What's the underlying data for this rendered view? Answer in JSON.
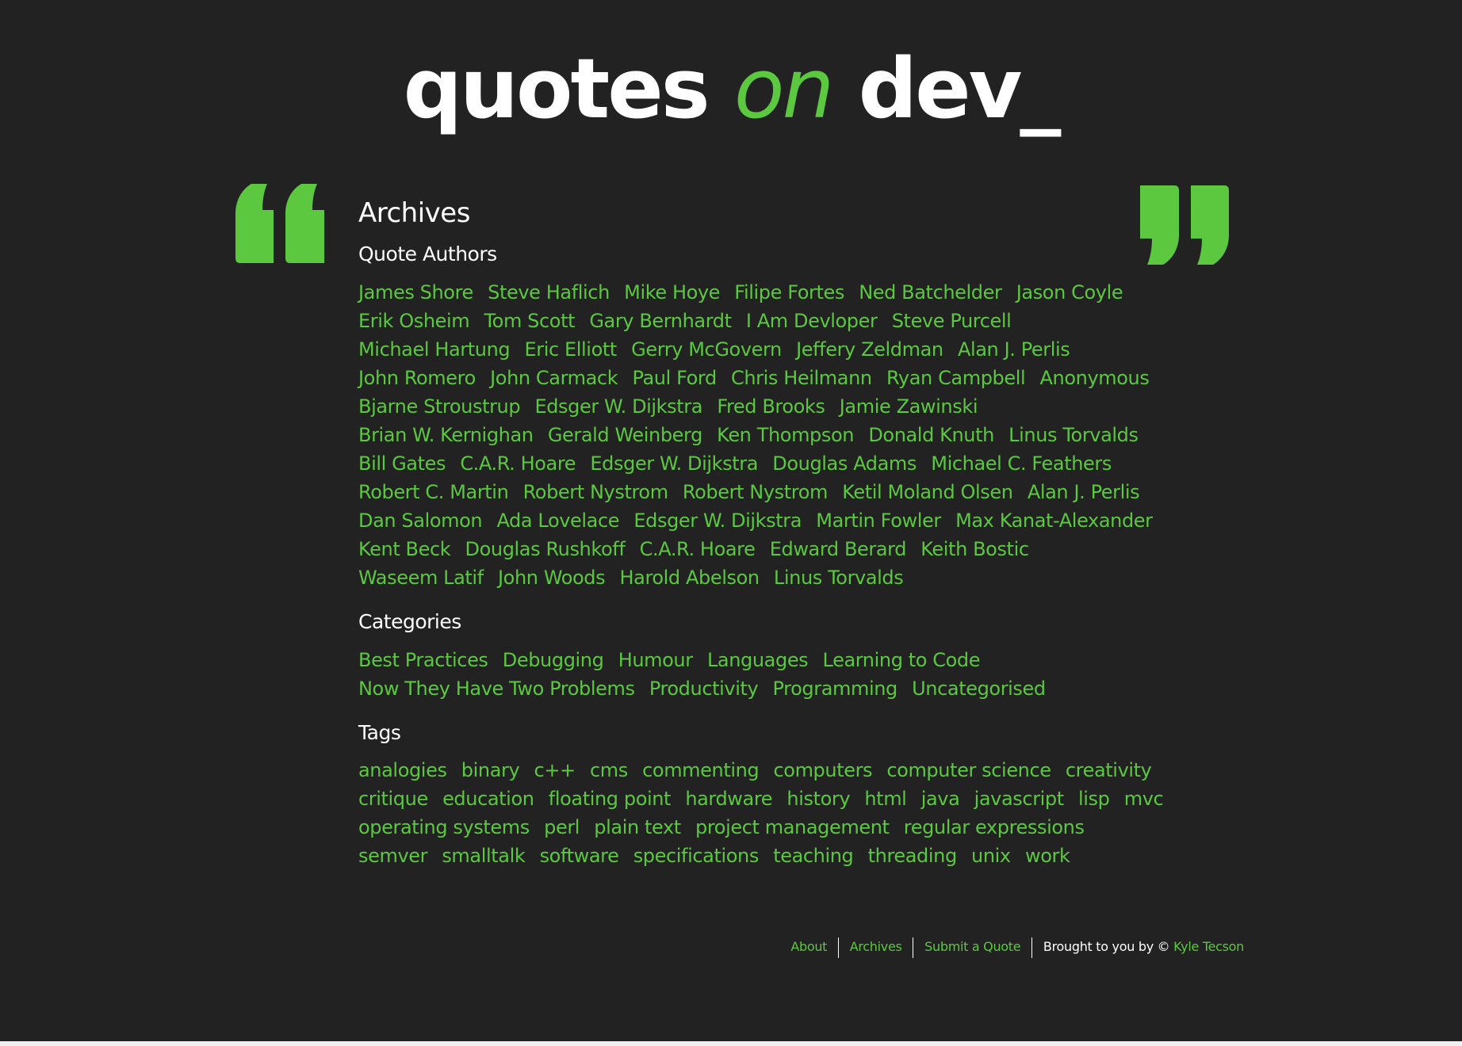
{
  "header": {
    "title_part1": "quotes",
    "title_part2": "on",
    "title_part3": "dev_"
  },
  "colors": {
    "background": "#222222",
    "accent": "#5bc840",
    "text": "#ffffff"
  },
  "icons": {
    "open_quote": "open-quote-icon",
    "close_quote": "close-quote-icon"
  },
  "main": {
    "page_title": "Archives",
    "authors": {
      "heading": "Quote Authors",
      "rows": [
        [
          "James Shore",
          "Steve Haflich",
          "Mike Hoye",
          "Filipe Fortes",
          "Ned Batchelder",
          "Jason Coyle"
        ],
        [
          "Erik Osheim",
          "Tom Scott",
          "Gary Bernhardt",
          "I Am Devloper",
          "Steve Purcell"
        ],
        [
          "Michael Hartung",
          "Eric Elliott",
          "Gerry McGovern",
          "Jeffery Zeldman",
          "Alan J. Perlis"
        ],
        [
          "John Romero",
          "John Carmack",
          "Paul Ford",
          "Chris Heilmann",
          "Ryan Campbell",
          "Anonymous"
        ],
        [
          "Bjarne Stroustrup",
          "Edsger W. Dijkstra",
          "Fred Brooks",
          "Jamie Zawinski"
        ],
        [
          "Brian W. Kernighan",
          "Gerald Weinberg",
          "Ken Thompson",
          "Donald Knuth",
          "Linus Torvalds"
        ],
        [
          "Bill Gates",
          "C.A.R. Hoare",
          "Edsger W. Dijkstra",
          "Douglas Adams",
          "Michael C. Feathers"
        ],
        [
          "Robert C. Martin",
          "Robert Nystrom",
          "Robert Nystrom",
          "Ketil Moland Olsen",
          "Alan J. Perlis"
        ],
        [
          "Dan Salomon",
          "Ada Lovelace",
          "Edsger W. Dijkstra",
          "Martin Fowler",
          "Max Kanat-Alexander"
        ],
        [
          "Kent Beck",
          "Douglas Rushkoff",
          "C.A.R. Hoare",
          "Edward Berard",
          "Keith Bostic"
        ],
        [
          "Waseem Latif",
          "John Woods",
          "Harold Abelson",
          "Linus Torvalds"
        ]
      ]
    },
    "categories": {
      "heading": "Categories",
      "rows": [
        [
          "Best Practices",
          "Debugging",
          "Humour",
          "Languages",
          "Learning to Code"
        ],
        [
          "Now They Have Two Problems",
          "Productivity",
          "Programming",
          "Uncategorised"
        ]
      ]
    },
    "tags": {
      "heading": "Tags",
      "rows": [
        [
          "analogies",
          "binary",
          "c++",
          "cms",
          "commenting",
          "computers",
          "computer science",
          "creativity"
        ],
        [
          "critique",
          "education",
          "floating point",
          "hardware",
          "history",
          "html",
          "java",
          "javascript",
          "lisp",
          "mvc"
        ],
        [
          "operating systems",
          "perl",
          "plain text",
          "project management",
          "regular expressions"
        ],
        [
          "semver",
          "smalltalk",
          "software",
          "specifications",
          "teaching",
          "threading",
          "unix",
          "work"
        ]
      ]
    }
  },
  "footer": {
    "about": "About",
    "archives": "Archives",
    "submit": "Submit a Quote",
    "credit_prefix": "Brought to you by ©",
    "credit_name": "Kyle Tecson"
  }
}
